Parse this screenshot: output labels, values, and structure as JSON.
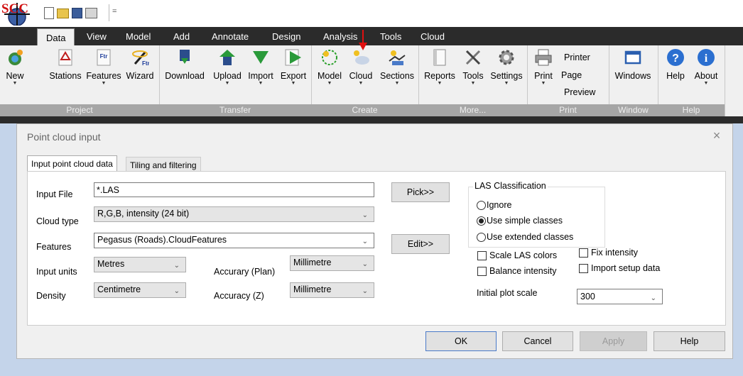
{
  "app": {
    "logo_text": "SCC",
    "quick_access_icons": [
      "new-file-icon",
      "open-folder-icon",
      "save-icon",
      "print-icon"
    ],
    "qat_dropdown": "="
  },
  "ribbon": {
    "tabs": [
      {
        "label": "Data",
        "active": true
      },
      {
        "label": "View"
      },
      {
        "label": "Model"
      },
      {
        "label": "Add"
      },
      {
        "label": "Annotate"
      },
      {
        "label": "Design"
      },
      {
        "label": "Analysis"
      },
      {
        "label": "Tools"
      },
      {
        "label": "Cloud"
      }
    ],
    "groups": {
      "project": {
        "label": "Project",
        "buttons": [
          "New",
          "Stations",
          "Features",
          "Wizard"
        ]
      },
      "transfer": {
        "label": "Transfer",
        "buttons": [
          "Download",
          "Upload",
          "Import",
          "Export"
        ]
      },
      "create": {
        "label": "Create",
        "buttons": [
          "Model",
          "Cloud",
          "Sections"
        ]
      },
      "more": {
        "label": "More...",
        "buttons": [
          "Reports",
          "Tools",
          "Settings"
        ]
      },
      "print": {
        "label": "Print",
        "buttons": [
          "Print",
          "Printer",
          "Page",
          "Preview"
        ]
      },
      "window": {
        "label": "Window",
        "buttons": [
          "Windows"
        ]
      },
      "help": {
        "label": "Help",
        "buttons": [
          "Help",
          "About"
        ]
      }
    },
    "icon_texts": {
      "ftr": "Ftr"
    }
  },
  "dialog": {
    "title": "Point cloud input",
    "close": "×",
    "tabs": [
      "Input point cloud data",
      "Tiling and filtering"
    ],
    "labels": {
      "input_file": "Input File",
      "cloud_type": "Cloud type",
      "features": "Features",
      "input_units": "Input units",
      "density": "Density",
      "accuracy_plan": "Accurary (Plan)",
      "accuracy_z": "Accuracy (Z)",
      "initial_plot_scale": "Initial plot scale"
    },
    "values": {
      "input_file": "*.LAS",
      "cloud_type": "R,G,B, intensity (24 bit)",
      "features": "Pegasus (Roads).CloudFeatures",
      "input_units": "Metres",
      "density": "Centimetre",
      "accuracy_plan": "Millimetre",
      "accuracy_z": "Millimetre",
      "initial_plot_scale": "300"
    },
    "buttons": {
      "pick": "Pick>>",
      "edit": "Edit>>",
      "ok": "OK",
      "cancel": "Cancel",
      "apply": "Apply",
      "help": "Help"
    },
    "las_classification": {
      "legend": "LAS Classification",
      "options": [
        "Ignore",
        "Use simple classes",
        "Use extended classes"
      ],
      "selected": "Use simple classes"
    },
    "checkboxes": [
      "Scale LAS colors",
      "Balance intensity",
      "Fix intensity",
      "Import setup data"
    ]
  }
}
